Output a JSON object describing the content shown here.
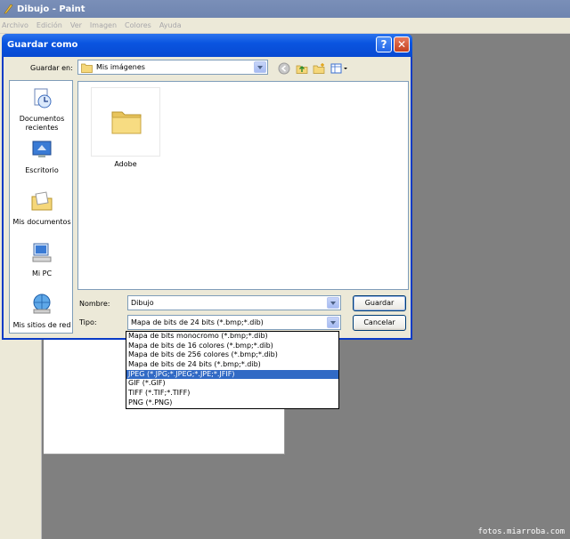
{
  "paint": {
    "title": "Dibujo - Paint",
    "menu": [
      "Archivo",
      "Edición",
      "Ver",
      "Imagen",
      "Colores",
      "Ayuda"
    ]
  },
  "dialog": {
    "title": "Guardar como",
    "save_in_label": "Guardar en:",
    "save_in_value": "Mis imágenes",
    "places": [
      {
        "label": "Documentos recientes",
        "icon": "recent-documents-icon"
      },
      {
        "label": "Escritorio",
        "icon": "desktop-icon"
      },
      {
        "label": "Mis documentos",
        "icon": "my-documents-icon"
      },
      {
        "label": "Mi PC",
        "icon": "my-computer-icon"
      },
      {
        "label": "Mis sitios de red",
        "icon": "network-places-icon"
      }
    ],
    "files": [
      {
        "name": "Adobe",
        "icon": "folder-icon"
      }
    ],
    "name_label": "Nombre:",
    "name_value": "Dibujo",
    "type_label": "Tipo:",
    "type_value": "Mapa de bits de 24 bits (*.bmp;*.dib)",
    "save_button": "Guardar",
    "cancel_button": "Cancelar",
    "type_options": [
      "Mapa de bits monocromo (*.bmp;*.dib)",
      "Mapa de bits de 16 colores (*.bmp;*.dib)",
      "Mapa de bits de 256 colores (*.bmp;*.dib)",
      "Mapa de bits de 24 bits (*.bmp;*.dib)",
      "JPEG (*.JPG;*.JPEG;*.JPE;*.JFIF)",
      "GIF (*.GIF)",
      "TIFF (*.TIF;*.TIFF)",
      "PNG (*.PNG)"
    ],
    "selected_type_index": 4
  },
  "watermark": "fotos.miarroba.com",
  "colors": {
    "titlebar": "#0a55e0",
    "selection": "#316ac5"
  }
}
